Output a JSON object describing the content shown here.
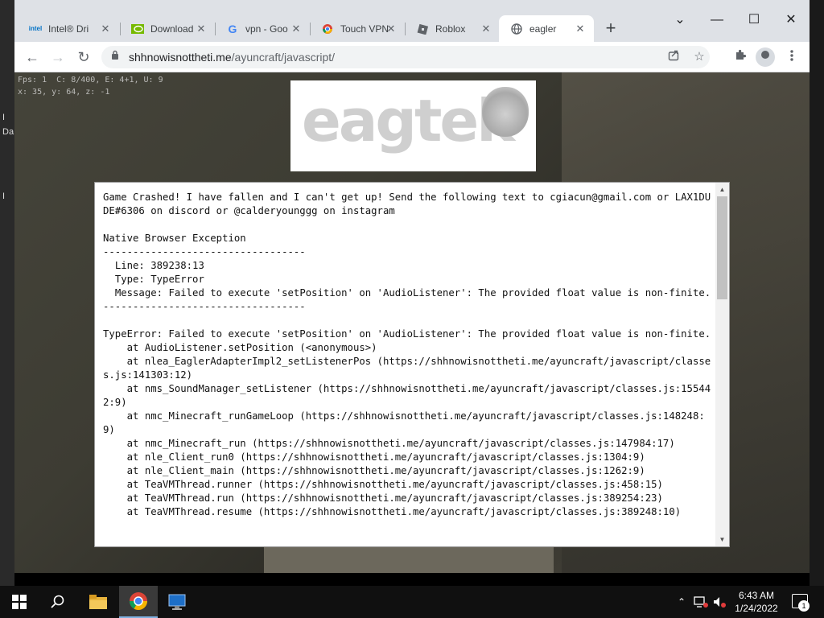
{
  "desktop": {
    "labels": [
      "I",
      "Da",
      "I"
    ]
  },
  "tabs": [
    {
      "title": "Intel® Dri",
      "icon": "intel"
    },
    {
      "title": "Download",
      "icon": "nvidia"
    },
    {
      "title": "vpn - Goo",
      "icon": "G"
    },
    {
      "title": "Touch VPN",
      "icon": "touchvpn"
    },
    {
      "title": "Roblox",
      "icon": "roblox"
    },
    {
      "title": "eagler",
      "icon": "globe"
    }
  ],
  "tab_close": "✕",
  "new_tab": "+",
  "window_controls": {
    "menu": "⌄",
    "minimize": "—",
    "maximize": "☐",
    "close": "✕"
  },
  "nav": {
    "back": "←",
    "forward": "→",
    "reload": "↻"
  },
  "address": {
    "host": "shhnowisnottheti.me",
    "path": "/ayuncraft/javascript/"
  },
  "game": {
    "debug_line1": "Fps: 1  C: 8/400, E: 4+1, U: 9",
    "debug_line2": "x: 35, y: 64, z: -1",
    "logo": "eagtek",
    "crash_text": "Game Crashed! I have fallen and I can't get up! Send the following text to cgiacun@gmail.com or LAX1DUDE#6306 on discord or @calderyounggg on instagram\n\nNative Browser Exception\n----------------------------------\n  Line: 389238:13\n  Type: TypeError\n  Message: Failed to execute 'setPosition' on 'AudioListener': The provided float value is non-finite.\n----------------------------------\n\nTypeError: Failed to execute 'setPosition' on 'AudioListener': The provided float value is non-finite.\n    at AudioListener.setPosition (<anonymous>)\n    at nlea_EaglerAdapterImpl2_setListenerPos (https://shhnowisnottheti.me/ayuncraft/javascript/classes.js:141303:12)\n    at nms_SoundManager_setListener (https://shhnowisnottheti.me/ayuncraft/javascript/classes.js:155442:9)\n    at nmc_Minecraft_runGameLoop (https://shhnowisnottheti.me/ayuncraft/javascript/classes.js:148248:9)\n    at nmc_Minecraft_run (https://shhnowisnottheti.me/ayuncraft/javascript/classes.js:147984:17)\n    at nle_Client_run0 (https://shhnowisnottheti.me/ayuncraft/javascript/classes.js:1304:9)\n    at nle_Client_main (https://shhnowisnottheti.me/ayuncraft/javascript/classes.js:1262:9)\n    at TeaVMThread.runner (https://shhnowisnottheti.me/ayuncraft/javascript/classes.js:458:15)\n    at TeaVMThread.run (https://shhnowisnottheti.me/ayuncraft/javascript/classes.js:389254:23)\n    at TeaVMThread.resume (https://shhnowisnottheti.me/ayuncraft/javascript/classes.js:389248:10)"
  },
  "taskbar": {
    "time": "6:43 AM",
    "date": "1/24/2022",
    "notification_count": "1"
  }
}
